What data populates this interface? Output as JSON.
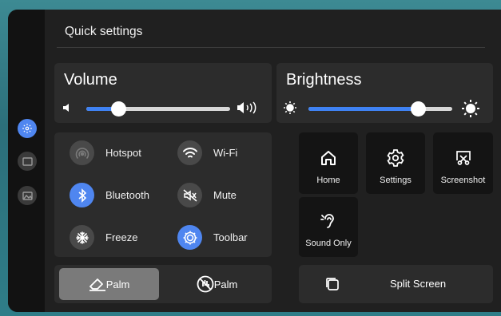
{
  "panel": {
    "title": "Quick settings"
  },
  "rail": {
    "items": [
      {
        "icon": "settings-gear-icon",
        "active": true
      },
      {
        "icon": "window-icon",
        "active": false
      },
      {
        "icon": "image-icon",
        "active": false
      }
    ]
  },
  "volume": {
    "label": "Volume",
    "level_percent": 22
  },
  "brightness": {
    "label": "Brightness",
    "level_percent": 76
  },
  "toggles": [
    {
      "label": "Hotspot",
      "icon": "hotspot-icon",
      "on": false
    },
    {
      "label": "Wi-Fi",
      "icon": "wifi-icon",
      "on": false
    },
    {
      "label": "Bluetooth",
      "icon": "bluetooth-icon",
      "on": true
    },
    {
      "label": "Mute",
      "icon": "mute-icon",
      "on": false
    },
    {
      "label": "Freeze",
      "icon": "freeze-icon",
      "on": false
    },
    {
      "label": "Toolbar",
      "icon": "toolbar-icon",
      "on": true
    }
  ],
  "tiles": [
    {
      "label": "Home",
      "icon": "home-icon"
    },
    {
      "label": "Settings",
      "icon": "settings-icon"
    },
    {
      "label": "Screenshot",
      "icon": "screenshot-icon"
    },
    {
      "label": "Sound Only",
      "icon": "sound-only-icon"
    }
  ],
  "palm": {
    "erase_label": "Palm",
    "erase_selected": true,
    "reject_label": "Palm",
    "reject_selected": false
  },
  "split_screen": {
    "label": "Split Screen",
    "icon": "split-screen-icon"
  },
  "colors": {
    "accent": "#4f86f0",
    "slider_fill": "#3f82f3",
    "panel_bg": "#202020",
    "card_bg": "#2c2c2c",
    "tile_bg": "#141414"
  }
}
